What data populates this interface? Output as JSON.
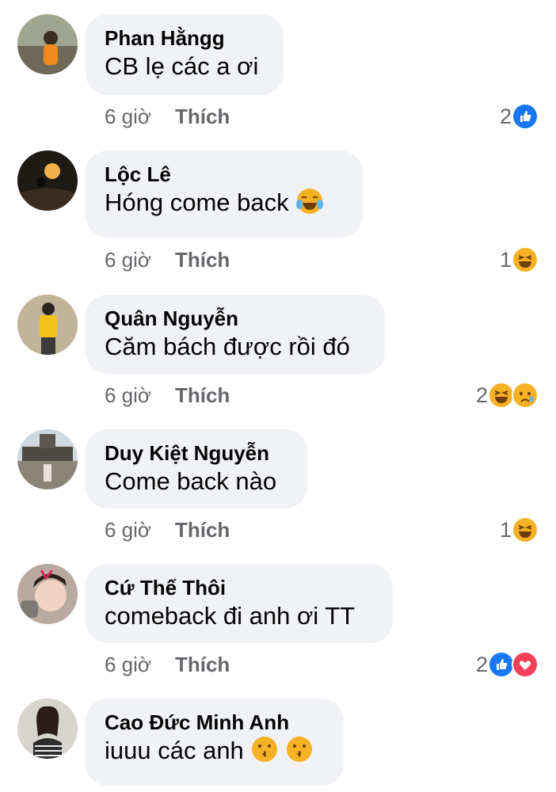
{
  "comments": [
    {
      "author": "Phan Hằngg",
      "text": "CB lẹ các a ơi",
      "time": "6 giờ",
      "like_label": "Thích",
      "reaction_count": "2",
      "reactions": [
        "like"
      ],
      "inline_emojis": []
    },
    {
      "author": "Lộc Lê",
      "text": "Hóng come back",
      "time": "6 giờ",
      "like_label": "Thích",
      "reaction_count": "1",
      "reactions": [
        "haha"
      ],
      "inline_emojis": [
        "tears-of-joy"
      ]
    },
    {
      "author": "Quân Nguyễn",
      "text": "Căm bách được rồi đó",
      "time": "6 giờ",
      "like_label": "Thích",
      "reaction_count": "2",
      "reactions": [
        "haha",
        "sad"
      ],
      "inline_emojis": []
    },
    {
      "author": "Duy Kiệt Nguyễn",
      "text": "Come back nào",
      "time": "6 giờ",
      "like_label": "Thích",
      "reaction_count": "1",
      "reactions": [
        "haha"
      ],
      "inline_emojis": []
    },
    {
      "author": "Cứ Thế Thôi",
      "text": "comeback đi anh ơi TT",
      "time": "6 giờ",
      "like_label": "Thích",
      "reaction_count": "2",
      "reactions": [
        "like",
        "love"
      ],
      "inline_emojis": []
    },
    {
      "author": "Cao Đức Minh Anh",
      "text": "iuuu các anh",
      "time": "",
      "like_label": "",
      "reaction_count": "",
      "reactions": [],
      "inline_emojis": [
        "kissing-face",
        "kissing-face"
      ]
    }
  ],
  "colors": {
    "bubble": "#f0f2f5",
    "meta": "#65676b",
    "like_blue": "#1877f2",
    "love_red": "#f33e58",
    "haha_yellow": "#f7b125"
  }
}
